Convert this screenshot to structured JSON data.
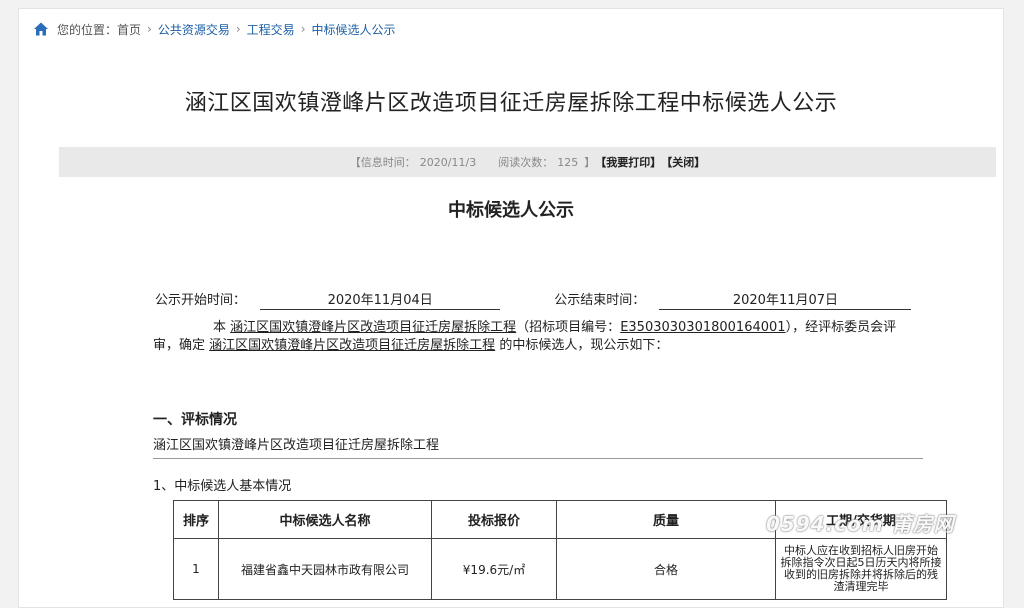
{
  "breadcrumb": {
    "prefix": "您的位置：",
    "home": "首页",
    "items": [
      "公共资源交易",
      "工程交易",
      "中标候选人公示"
    ],
    "separator": "›"
  },
  "title": "涵江区国欢镇澄峰片区改造项目征迁房屋拆除工程中标候选人公示",
  "info": {
    "time_label": "【信息时间：",
    "time_value": "2020/11/3",
    "views_label": "阅读次数：",
    "views_value": "125",
    "bracket_close": "】",
    "print": "【我要打印】",
    "close": "【关闭】"
  },
  "notice_title": "中标候选人公示",
  "times": {
    "start_label": "公示开始时间：",
    "start_value": "2020年11月04日",
    "end_label": "公示结束时间：",
    "end_value": "2020年11月07日"
  },
  "paragraph": {
    "p1": "本",
    "project": "涵江区国欢镇澄峰片区改造项目征迁房屋拆除工程",
    "p2": "（招标项目编号：",
    "code": "E3503030301800164001",
    "p3": "），经评标委员会评审，确定",
    "project2": "涵江区国欢镇澄峰片区改造项目征迁房屋拆除工程",
    "p4": "的中标候选人，现公示如下："
  },
  "section": {
    "heading": "一、评标情况",
    "line": "涵江区国欢镇澄峰片区改造项目征迁房屋拆除工程",
    "sub_heading": "1、中标候选人基本情况"
  },
  "table": {
    "headers": [
      "排序",
      "中标候选人名称",
      "投标报价",
      "质量",
      "工期/交货期"
    ],
    "rows": [
      {
        "rank": "1",
        "name": "福建省鑫中天园林市政有限公司",
        "price": "¥19.6元/㎡",
        "quality": "合格",
        "period": "中标人应在收到招标人旧房开始拆除指令次日起5日历天内将所接收到的旧房拆除并将拆除后的残渣清理完毕"
      }
    ]
  },
  "watermark": "0594.com 莆房网",
  "colors": {
    "link": "#1b5fa5",
    "info_bar": "#e9e9e9",
    "home_icon": "#2a6db8"
  }
}
